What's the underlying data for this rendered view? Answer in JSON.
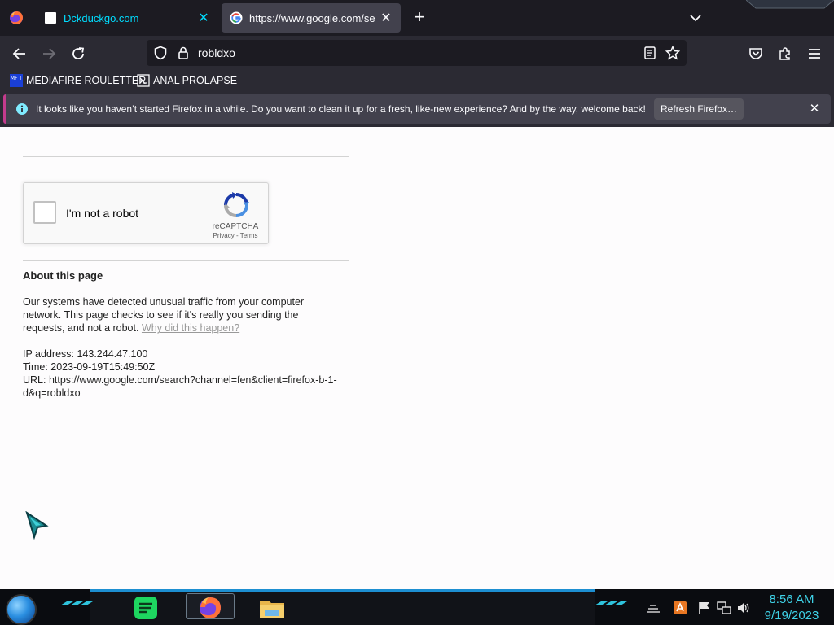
{
  "browser": {
    "tabs": [
      {
        "title": "Dckduckgo.com",
        "active": false
      },
      {
        "title": "https://www.google.com/search",
        "active": true
      }
    ],
    "url": "robldxo"
  },
  "bookmarks": [
    {
      "label": "MEDIAFIRE ROULETTER",
      "icon": "mft-icon",
      "icon_text": "MF T"
    },
    {
      "label": "ANAL PROLAPSE",
      "icon": "terminal-icon"
    }
  ],
  "notification": {
    "message": "It looks like you haven’t started Firefox in a while. Do you want to clean it up for a fresh, like-new experience? And by the way, welcome back!",
    "button": "Refresh Firefox…"
  },
  "captcha": {
    "label": "I'm not a robot",
    "brand": "reCAPTCHA",
    "links": "Privacy - Terms"
  },
  "about": {
    "title": "About this page",
    "line1": "Our systems have detected unusual traffic from your computer",
    "line2": "network. This page checks to see if it's really you sending the",
    "line3_prefix": "requests, and not a robot.",
    "why_link": "Why did this happen?",
    "ip": "IP address: 143.244.47.100",
    "time": "Time: 2023-09-19T15:49:50Z",
    "url_line1": "URL: https://www.google.com/search?channel=fen&client=firefox-b-1-",
    "url_line2": "d&q=robldxo"
  },
  "taskbar": {
    "time": "8:56 AM",
    "date": "9/19/2023",
    "apps": [
      "spotify-icon",
      "firefox-icon",
      "file-explorer-icon"
    ],
    "tray": [
      "network-icon",
      "flag-icon",
      "app-icon",
      "volume-icon"
    ]
  },
  "colors": {
    "accent_cyan": "#00ddff",
    "notice_accent": "#c43b8d",
    "taskbar_accent": "#1d8fd1",
    "clock": "#3fd3e8"
  }
}
